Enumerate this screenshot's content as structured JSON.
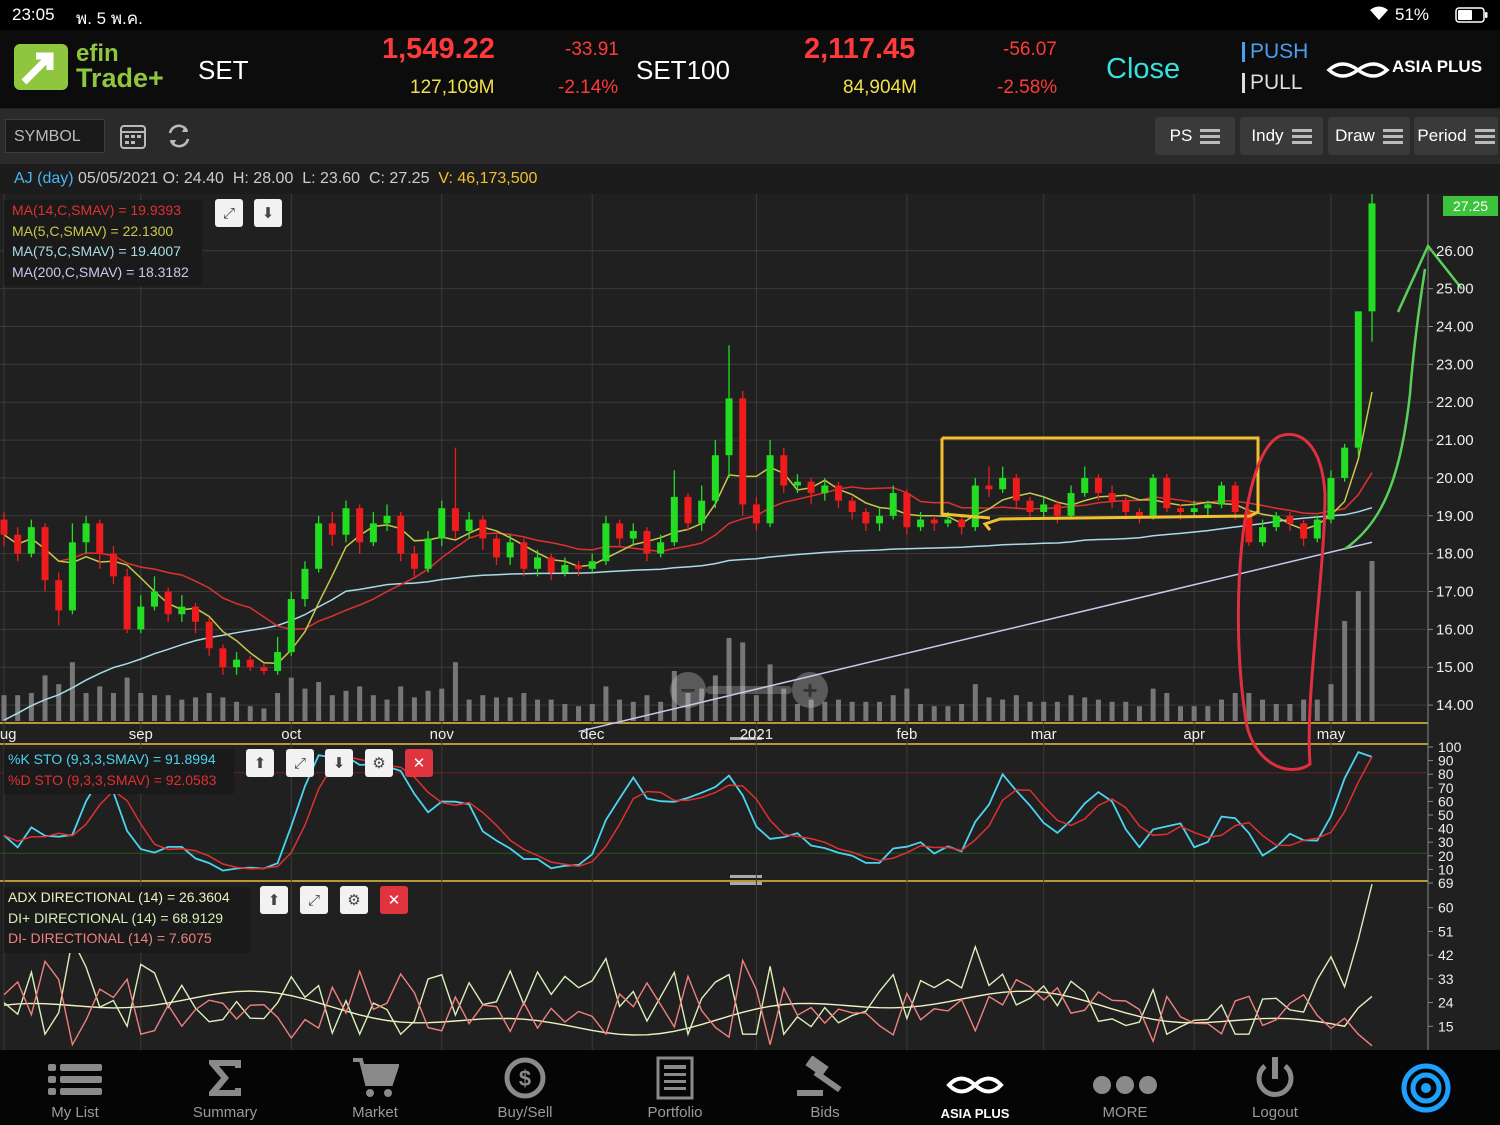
{
  "status": {
    "time": "23:05",
    "date": "พ. 5 พ.ค.",
    "battery": "51%"
  },
  "header": {
    "logo_top": "efin",
    "logo_bottom": "Trade+",
    "set_label": "SET",
    "set_value": "1,549.22",
    "set_change": "-33.91",
    "set_volume": "127,109M",
    "set_pct": "-2.14%",
    "set100_label": "SET100",
    "set100_value": "2,117.45",
    "set100_change": "-56.07",
    "set100_volume": "84,904M",
    "set100_pct": "-2.58%",
    "market_status": "Close",
    "push_label": "PUSH",
    "pull_label": "PULL",
    "brand": "ASIA PLUS"
  },
  "toolbar": {
    "symbol_placeholder": "SYMBOL",
    "buttons": [
      {
        "label": "PS"
      },
      {
        "label": "Indy"
      },
      {
        "label": "Draw"
      },
      {
        "label": "Period"
      }
    ]
  },
  "infobar": {
    "symbol": "AJ (day)",
    "date": "05/05/2021",
    "o_label": "O:",
    "o": "24.40",
    "h_label": "H:",
    "h": "28.00",
    "l_label": "L:",
    "l": "23.60",
    "c_label": "C:",
    "c": "27.25",
    "v_label": "V:",
    "v": "46,173,500"
  },
  "main_panel": {
    "legend": [
      {
        "text": "MA(14,C,SMAV) = 19.9393",
        "color": "#e03030"
      },
      {
        "text": "MA(5,C,SMAV) = 22.1300",
        "color": "#c8c84a"
      },
      {
        "text": "MA(75,C,SMAV) = 19.4007",
        "color": "#a8dce8"
      },
      {
        "text": "MA(200,C,SMAV) = 18.3182",
        "color": "#c8c8f0"
      }
    ],
    "last_price_tag": "27.25",
    "y_ticks": [
      "26.00",
      "25.00",
      "24.00",
      "23.00",
      "22.00",
      "21.00",
      "20.00",
      "19.00",
      "18.00",
      "17.00",
      "16.00",
      "15.00",
      "14.00"
    ],
    "months": [
      "aug",
      "sep",
      "oct",
      "nov",
      "dec",
      "2021",
      "feb",
      "mar",
      "apr",
      "may"
    ]
  },
  "sto_panel": {
    "legend": [
      {
        "text": "%K STO (9,3,3,SMAV) = 91.8994",
        "color": "#4cd4f0"
      },
      {
        "text": "%D STO (9,3,3,SMAV) = 92.0583",
        "color": "#e03030"
      }
    ],
    "y_ticks": [
      "100",
      "90",
      "80",
      "70",
      "60",
      "50",
      "40",
      "30",
      "20",
      "10",
      "69"
    ]
  },
  "adx_panel": {
    "legend": [
      {
        "text": "ADX DIRECTIONAL (14) = 26.3604",
        "color": "#f0f0c0"
      },
      {
        "text": "DI+ DIRECTIONAL (14) = 68.9129",
        "color": "#d8f0b8"
      },
      {
        "text": "DI- DIRECTIONAL (14) = 7.6075",
        "color": "#f08080"
      }
    ],
    "y_ticks": [
      "60",
      "51",
      "42",
      "33",
      "24",
      "15"
    ]
  },
  "chart_data": {
    "type": "candlestick",
    "symbol": "AJ",
    "ylim": [
      13.5,
      27.5
    ],
    "candles": [
      {
        "m": "aug",
        "o": 18.9,
        "c": 18.5,
        "h": 19.1,
        "l": 18.2
      },
      {
        "m": "aug",
        "o": 18.5,
        "c": 18.0,
        "h": 18.7,
        "l": 17.8
      },
      {
        "m": "aug",
        "o": 18.0,
        "c": 18.7,
        "h": 18.9,
        "l": 17.9
      },
      {
        "m": "aug",
        "o": 18.7,
        "c": 17.3,
        "h": 18.8,
        "l": 17.0
      },
      {
        "m": "aug",
        "o": 17.3,
        "c": 16.5,
        "h": 17.5,
        "l": 16.1
      },
      {
        "m": "aug",
        "o": 16.5,
        "c": 18.3,
        "h": 18.8,
        "l": 16.4
      },
      {
        "m": "aug",
        "o": 18.3,
        "c": 18.8,
        "h": 19.0,
        "l": 18.0
      },
      {
        "m": "aug",
        "o": 18.8,
        "c": 18.0,
        "h": 18.9,
        "l": 17.6
      },
      {
        "m": "aug",
        "o": 18.0,
        "c": 17.4,
        "h": 18.2,
        "l": 17.2
      },
      {
        "m": "aug",
        "o": 17.4,
        "c": 16.0,
        "h": 17.6,
        "l": 15.9
      },
      {
        "m": "sep",
        "o": 16.0,
        "c": 16.6,
        "h": 16.9,
        "l": 15.9
      },
      {
        "m": "sep",
        "o": 16.6,
        "c": 17.0,
        "h": 17.4,
        "l": 16.5
      },
      {
        "m": "sep",
        "o": 17.0,
        "c": 16.4,
        "h": 17.1,
        "l": 16.2
      },
      {
        "m": "sep",
        "o": 16.4,
        "c": 16.6,
        "h": 16.9,
        "l": 16.2
      },
      {
        "m": "sep",
        "o": 16.6,
        "c": 16.2,
        "h": 16.7,
        "l": 15.9
      },
      {
        "m": "sep",
        "o": 16.2,
        "c": 15.5,
        "h": 16.3,
        "l": 15.3
      },
      {
        "m": "sep",
        "o": 15.5,
        "c": 15.0,
        "h": 15.6,
        "l": 14.8
      },
      {
        "m": "sep",
        "o": 15.0,
        "c": 15.2,
        "h": 15.4,
        "l": 14.8
      },
      {
        "m": "sep",
        "o": 15.2,
        "c": 15.0,
        "h": 15.3,
        "l": 14.9
      },
      {
        "m": "sep",
        "o": 15.0,
        "c": 14.9,
        "h": 15.1,
        "l": 14.8
      },
      {
        "m": "sep",
        "o": 14.9,
        "c": 15.4,
        "h": 15.8,
        "l": 14.8
      },
      {
        "m": "oct",
        "o": 15.4,
        "c": 16.8,
        "h": 17.0,
        "l": 15.3
      },
      {
        "m": "oct",
        "o": 16.8,
        "c": 17.6,
        "h": 17.8,
        "l": 16.6
      },
      {
        "m": "oct",
        "o": 17.6,
        "c": 18.8,
        "h": 19.0,
        "l": 17.5
      },
      {
        "m": "oct",
        "o": 18.8,
        "c": 18.5,
        "h": 19.1,
        "l": 18.2
      },
      {
        "m": "oct",
        "o": 18.5,
        "c": 19.2,
        "h": 19.4,
        "l": 18.3
      },
      {
        "m": "oct",
        "o": 19.2,
        "c": 18.3,
        "h": 19.3,
        "l": 18.0
      },
      {
        "m": "oct",
        "o": 18.3,
        "c": 18.8,
        "h": 19.1,
        "l": 18.2
      },
      {
        "m": "oct",
        "o": 18.8,
        "c": 19.0,
        "h": 19.3,
        "l": 18.6
      },
      {
        "m": "oct",
        "o": 19.0,
        "c": 18.0,
        "h": 19.1,
        "l": 17.8
      },
      {
        "m": "oct",
        "o": 18.0,
        "c": 17.6,
        "h": 18.2,
        "l": 17.4
      },
      {
        "m": "oct",
        "o": 17.6,
        "c": 18.4,
        "h": 18.6,
        "l": 17.5
      },
      {
        "m": "nov",
        "o": 18.4,
        "c": 19.2,
        "h": 19.4,
        "l": 18.2
      },
      {
        "m": "nov",
        "o": 19.2,
        "c": 18.6,
        "h": 20.8,
        "l": 18.4
      },
      {
        "m": "nov",
        "o": 18.6,
        "c": 18.9,
        "h": 19.1,
        "l": 18.4
      },
      {
        "m": "nov",
        "o": 18.9,
        "c": 18.4,
        "h": 19.0,
        "l": 18.1
      },
      {
        "m": "nov",
        "o": 18.4,
        "c": 17.9,
        "h": 18.5,
        "l": 17.7
      },
      {
        "m": "nov",
        "o": 17.9,
        "c": 18.3,
        "h": 18.5,
        "l": 17.7
      },
      {
        "m": "nov",
        "o": 18.3,
        "c": 17.6,
        "h": 18.4,
        "l": 17.4
      },
      {
        "m": "nov",
        "o": 17.6,
        "c": 17.9,
        "h": 18.1,
        "l": 17.4
      },
      {
        "m": "nov",
        "o": 17.9,
        "c": 17.5,
        "h": 18.0,
        "l": 17.3
      },
      {
        "m": "nov",
        "o": 17.5,
        "c": 17.7,
        "h": 17.9,
        "l": 17.4
      },
      {
        "m": "nov",
        "o": 17.7,
        "c": 17.6,
        "h": 17.8,
        "l": 17.4
      },
      {
        "m": "dec",
        "o": 17.6,
        "c": 17.8,
        "h": 18.0,
        "l": 17.5
      },
      {
        "m": "dec",
        "o": 17.8,
        "c": 18.8,
        "h": 19.0,
        "l": 17.7
      },
      {
        "m": "dec",
        "o": 18.8,
        "c": 18.4,
        "h": 18.9,
        "l": 18.2
      },
      {
        "m": "dec",
        "o": 18.4,
        "c": 18.6,
        "h": 18.8,
        "l": 18.2
      },
      {
        "m": "dec",
        "o": 18.6,
        "c": 18.0,
        "h": 18.7,
        "l": 17.8
      },
      {
        "m": "dec",
        "o": 18.0,
        "c": 18.3,
        "h": 18.5,
        "l": 17.9
      },
      {
        "m": "dec",
        "o": 18.3,
        "c": 19.5,
        "h": 20.2,
        "l": 18.2
      },
      {
        "m": "dec",
        "o": 19.5,
        "c": 18.8,
        "h": 19.6,
        "l": 18.6
      },
      {
        "m": "dec",
        "o": 18.8,
        "c": 19.4,
        "h": 19.8,
        "l": 18.6
      },
      {
        "m": "dec",
        "o": 19.4,
        "c": 20.6,
        "h": 21.0,
        "l": 19.2
      },
      {
        "m": "dec",
        "o": 20.6,
        "c": 22.1,
        "h": 23.5,
        "l": 20.0
      },
      {
        "m": "dec",
        "o": 22.1,
        "c": 19.3,
        "h": 22.3,
        "l": 19.0
      },
      {
        "m": "2021",
        "o": 19.3,
        "c": 18.8,
        "h": 19.5,
        "l": 18.6
      },
      {
        "m": "2021",
        "o": 18.8,
        "c": 20.6,
        "h": 21.0,
        "l": 18.7
      },
      {
        "m": "2021",
        "o": 20.6,
        "c": 19.8,
        "h": 20.8,
        "l": 19.6
      },
      {
        "m": "2021",
        "o": 19.8,
        "c": 19.9,
        "h": 20.1,
        "l": 19.6
      },
      {
        "m": "2021",
        "o": 19.9,
        "c": 19.6,
        "h": 20.0,
        "l": 19.3
      },
      {
        "m": "2021",
        "o": 19.6,
        "c": 19.8,
        "h": 20.0,
        "l": 19.4
      },
      {
        "m": "2021",
        "o": 19.8,
        "c": 19.4,
        "h": 19.9,
        "l": 19.2
      },
      {
        "m": "2021",
        "o": 19.4,
        "c": 19.1,
        "h": 19.5,
        "l": 18.9
      },
      {
        "m": "2021",
        "o": 19.1,
        "c": 18.8,
        "h": 19.2,
        "l": 18.6
      },
      {
        "m": "2021",
        "o": 18.8,
        "c": 19.0,
        "h": 19.2,
        "l": 18.6
      },
      {
        "m": "2021",
        "o": 19.0,
        "c": 19.6,
        "h": 19.8,
        "l": 18.9
      },
      {
        "m": "feb",
        "o": 19.6,
        "c": 18.7,
        "h": 19.7,
        "l": 18.5
      },
      {
        "m": "feb",
        "o": 18.7,
        "c": 18.9,
        "h": 19.1,
        "l": 18.6
      },
      {
        "m": "feb",
        "o": 18.9,
        "c": 18.8,
        "h": 19.0,
        "l": 18.6
      },
      {
        "m": "feb",
        "o": 18.8,
        "c": 18.9,
        "h": 19.1,
        "l": 18.7
      },
      {
        "m": "feb",
        "o": 18.9,
        "c": 18.7,
        "h": 19.0,
        "l": 18.5
      },
      {
        "m": "feb",
        "o": 18.7,
        "c": 19.8,
        "h": 20.0,
        "l": 18.6
      },
      {
        "m": "feb",
        "o": 19.8,
        "c": 19.7,
        "h": 20.3,
        "l": 19.5
      },
      {
        "m": "feb",
        "o": 19.7,
        "c": 20.0,
        "h": 20.3,
        "l": 19.6
      },
      {
        "m": "feb",
        "o": 20.0,
        "c": 19.4,
        "h": 20.1,
        "l": 19.2
      },
      {
        "m": "feb",
        "o": 19.4,
        "c": 19.1,
        "h": 19.5,
        "l": 18.9
      },
      {
        "m": "mar",
        "o": 19.1,
        "c": 19.3,
        "h": 19.5,
        "l": 18.9
      },
      {
        "m": "mar",
        "o": 19.3,
        "c": 19.0,
        "h": 19.4,
        "l": 18.8
      },
      {
        "m": "mar",
        "o": 19.0,
        "c": 19.6,
        "h": 19.8,
        "l": 18.9
      },
      {
        "m": "mar",
        "o": 19.6,
        "c": 20.0,
        "h": 20.3,
        "l": 19.5
      },
      {
        "m": "mar",
        "o": 20.0,
        "c": 19.6,
        "h": 20.1,
        "l": 19.4
      },
      {
        "m": "mar",
        "o": 19.6,
        "c": 19.4,
        "h": 19.8,
        "l": 19.2
      },
      {
        "m": "mar",
        "o": 19.4,
        "c": 19.1,
        "h": 19.5,
        "l": 18.9
      },
      {
        "m": "mar",
        "o": 19.1,
        "c": 19.0,
        "h": 19.2,
        "l": 18.8
      },
      {
        "m": "mar",
        "o": 19.0,
        "c": 20.0,
        "h": 20.1,
        "l": 18.9
      },
      {
        "m": "mar",
        "o": 20.0,
        "c": 19.2,
        "h": 20.1,
        "l": 19.1
      },
      {
        "m": "mar",
        "o": 19.2,
        "c": 19.1,
        "h": 19.3,
        "l": 18.9
      },
      {
        "m": "apr",
        "o": 19.1,
        "c": 19.2,
        "h": 19.4,
        "l": 19.0
      },
      {
        "m": "apr",
        "o": 19.2,
        "c": 19.3,
        "h": 19.4,
        "l": 19.0
      },
      {
        "m": "apr",
        "o": 19.3,
        "c": 19.8,
        "h": 19.9,
        "l": 19.2
      },
      {
        "m": "apr",
        "o": 19.8,
        "c": 19.1,
        "h": 19.9,
        "l": 18.9
      },
      {
        "m": "apr",
        "o": 19.1,
        "c": 18.3,
        "h": 19.2,
        "l": 18.2
      },
      {
        "m": "apr",
        "o": 18.3,
        "c": 18.7,
        "h": 18.9,
        "l": 18.2
      },
      {
        "m": "apr",
        "o": 18.7,
        "c": 19.0,
        "h": 19.1,
        "l": 18.6
      },
      {
        "m": "apr",
        "o": 19.0,
        "c": 18.8,
        "h": 19.1,
        "l": 18.6
      },
      {
        "m": "apr",
        "o": 18.8,
        "c": 18.4,
        "h": 18.9,
        "l": 18.2
      },
      {
        "m": "apr",
        "o": 18.4,
        "c": 18.9,
        "h": 19.0,
        "l": 18.3
      },
      {
        "m": "may",
        "o": 18.9,
        "c": 20.0,
        "h": 20.2,
        "l": 18.8
      },
      {
        "m": "may",
        "o": 20.0,
        "c": 20.8,
        "h": 20.9,
        "l": 19.9
      },
      {
        "m": "may",
        "o": 20.8,
        "c": 24.4,
        "h": 24.4,
        "l": 20.6
      },
      {
        "m": "may",
        "o": 24.4,
        "c": 27.25,
        "h": 28.0,
        "l": 23.6
      }
    ],
    "ma200": [
      13.3,
      18.3
    ],
    "stochastic": {
      "k_last": 91.8994,
      "d_last": 92.0583
    },
    "adx": {
      "adx_last": 26.3604,
      "di_plus_last": 68.9129,
      "di_minus_last": 7.6075
    }
  },
  "tabbar": {
    "tabs": [
      {
        "label": "My List",
        "icon": "list-icon"
      },
      {
        "label": "Summary",
        "icon": "sigma-icon"
      },
      {
        "label": "Market",
        "icon": "cart-icon"
      },
      {
        "label": "Buy/Sell",
        "icon": "dollar-icon"
      },
      {
        "label": "Portfolio",
        "icon": "document-icon"
      },
      {
        "label": "Bids",
        "icon": "gavel-icon"
      },
      {
        "label": "ASIA PLUS",
        "icon": "asiaplus-icon"
      },
      {
        "label": "MORE",
        "icon": "dots-icon"
      },
      {
        "label": "Logout",
        "icon": "power-icon"
      }
    ]
  }
}
